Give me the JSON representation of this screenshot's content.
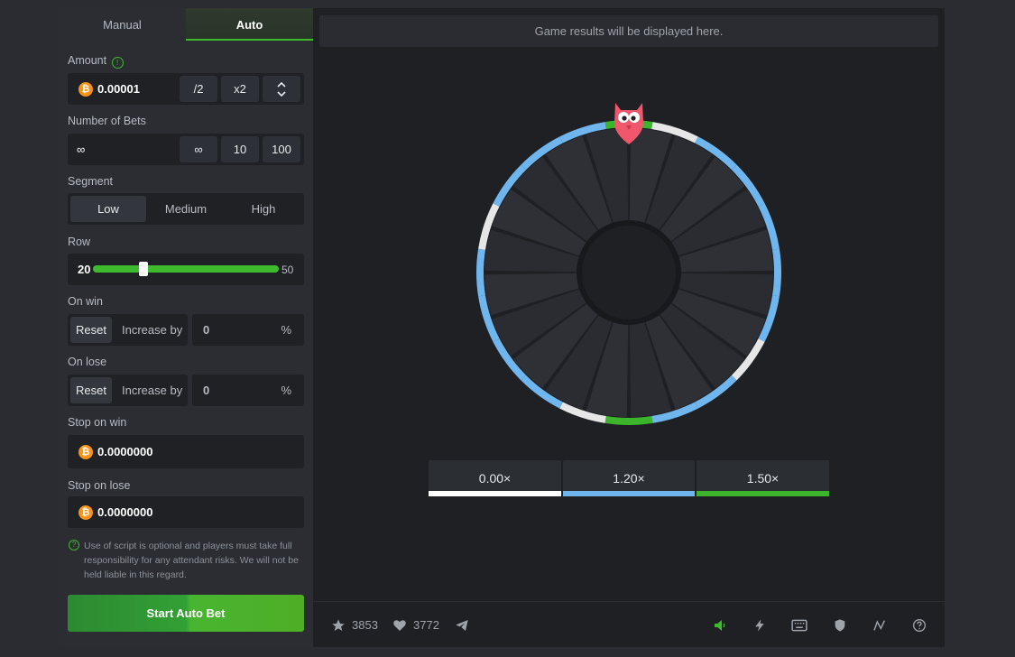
{
  "tabs": {
    "manual": "Manual",
    "auto": "Auto"
  },
  "amount": {
    "label": "Amount",
    "value": "0.00001",
    "half": "/2",
    "double": "x2"
  },
  "bets": {
    "label": "Number of Bets",
    "value": "∞",
    "opt1": "∞",
    "opt2": "10",
    "opt3": "100"
  },
  "segment": {
    "label": "Segment",
    "low": "Low",
    "medium": "Medium",
    "high": "High",
    "selected": "Low"
  },
  "row": {
    "label": "Row",
    "min": "20",
    "max": "50",
    "level_fraction": 0.27
  },
  "on_win": {
    "label": "On win",
    "reset": "Reset",
    "increase": "Increase by",
    "value": "0",
    "unit": "%"
  },
  "on_lose": {
    "label": "On lose",
    "reset": "Reset",
    "increase": "Increase by",
    "value": "0",
    "unit": "%"
  },
  "stop_win": {
    "label": "Stop on win",
    "value": "0.0000000"
  },
  "stop_lose": {
    "label": "Stop on lose",
    "value": "0.0000000"
  },
  "note": "Use of script is optional and players must take full responsibility for any attendant risks. We will not be held liable in this regard.",
  "start_button": "Start Auto Bet",
  "results_placeholder": "Game results will be displayed here.",
  "multipliers": [
    {
      "label": "0.00×",
      "color": "#ffffff"
    },
    {
      "label": "1.20×",
      "color": "#6fb6ee"
    },
    {
      "label": "1.50×",
      "color": "#3cb52c"
    }
  ],
  "footer": {
    "stars": "3853",
    "likes": "3772"
  },
  "colors": {
    "accent": "#3dba2e",
    "blue": "#6fb6ee",
    "white": "#e6e6e6",
    "bitcoin": "#f7931a"
  },
  "icons": [
    "star-icon",
    "heart-icon",
    "telegram-icon",
    "sound-icon",
    "lightning-icon",
    "keyboard-icon",
    "shield-icon",
    "chart-icon",
    "help-icon"
  ]
}
